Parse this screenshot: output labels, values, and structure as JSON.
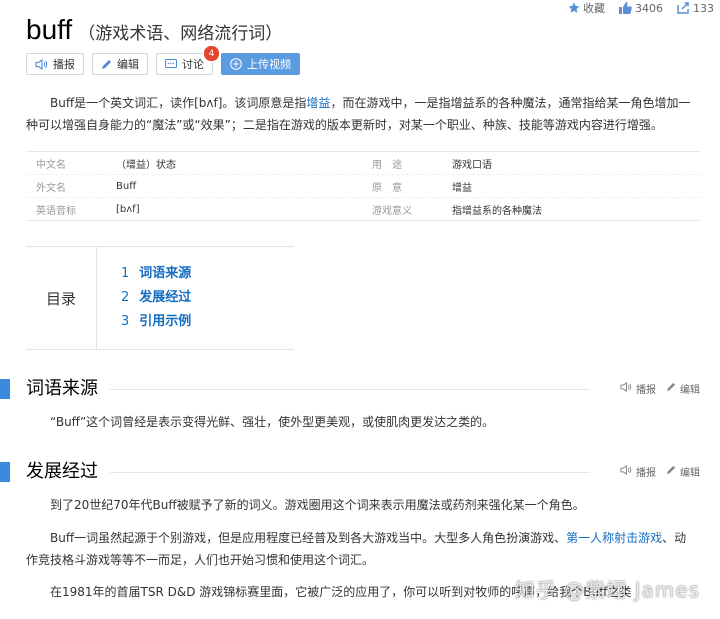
{
  "stats": {
    "favorite_label": "收藏",
    "likes": "3406",
    "shares": "133"
  },
  "title": {
    "main": "buff",
    "sub": "（游戏术语、网络流行词）"
  },
  "actions": {
    "play": "播报",
    "edit": "编辑",
    "discuss": "讨论",
    "discuss_count": "4",
    "upload": "上传视频"
  },
  "intro": {
    "part1": "Buff是一个英文词汇，读作[bʌf]。该词原意是指",
    "link": "增益",
    "part2": "，而在游戏中，一是指增益系的各种魔法，通常指给某一角色增加一种可以增强自身能力的“魔法”或“效果”；二是指在游戏的版本更新时，对某一个职业、种族、技能等游戏内容进行增强。"
  },
  "infobox": {
    "rows": [
      {
        "l1": "中文名",
        "v1": "（增益）状态",
        "l2": "用　途",
        "v2": "游戏口语"
      },
      {
        "l1": "外文名",
        "v1": "Buff",
        "l2": "原　意",
        "v2": "增益"
      },
      {
        "l1": "英语音标",
        "v1": "[bʌf]",
        "l2": "游戏意义",
        "v2": "指增益系的各种魔法"
      }
    ]
  },
  "toc": {
    "title": "目录",
    "items": [
      {
        "num": "1",
        "label": "词语来源"
      },
      {
        "num": "2",
        "label": "发展经过"
      },
      {
        "num": "3",
        "label": "引用示例"
      }
    ]
  },
  "sections": {
    "s1": {
      "title": "词语来源",
      "play": "播报",
      "edit": "编辑",
      "para": "“Buff”这个词曾经是表示变得光鲜、强壮，使外型更美观，或使肌肉更发达之类的。"
    },
    "s2": {
      "title": "发展经过",
      "play": "播报",
      "edit": "编辑",
      "para1": "到了20世纪70年代Buff被赋予了新的词义。游戏圈用这个词来表示用魔法或药剂来强化某一个角色。",
      "para2_a": "Buff一词虽然起源于个别游戏，但是应用程度已经普及到各大游戏当中。大型多人角色扮演游戏、",
      "para2_link": "第一人称射击游戏",
      "para2_b": "、动作竞技格斗游戏等等不一而足，人们也开始习惯和使用这个词汇。",
      "para3": "在1981年的首届TSR D&D 游戏锦标赛里面，它被广泛的应用了，你可以听到对牧师的呼声，给我个Buff之类"
    }
  },
  "watermark": "知乎 @紫翊 James",
  "colors": {
    "accent": "#3a8be0",
    "link": "#136ec2",
    "badge": "#e5442f",
    "upload_button": "#5b9bdf"
  }
}
